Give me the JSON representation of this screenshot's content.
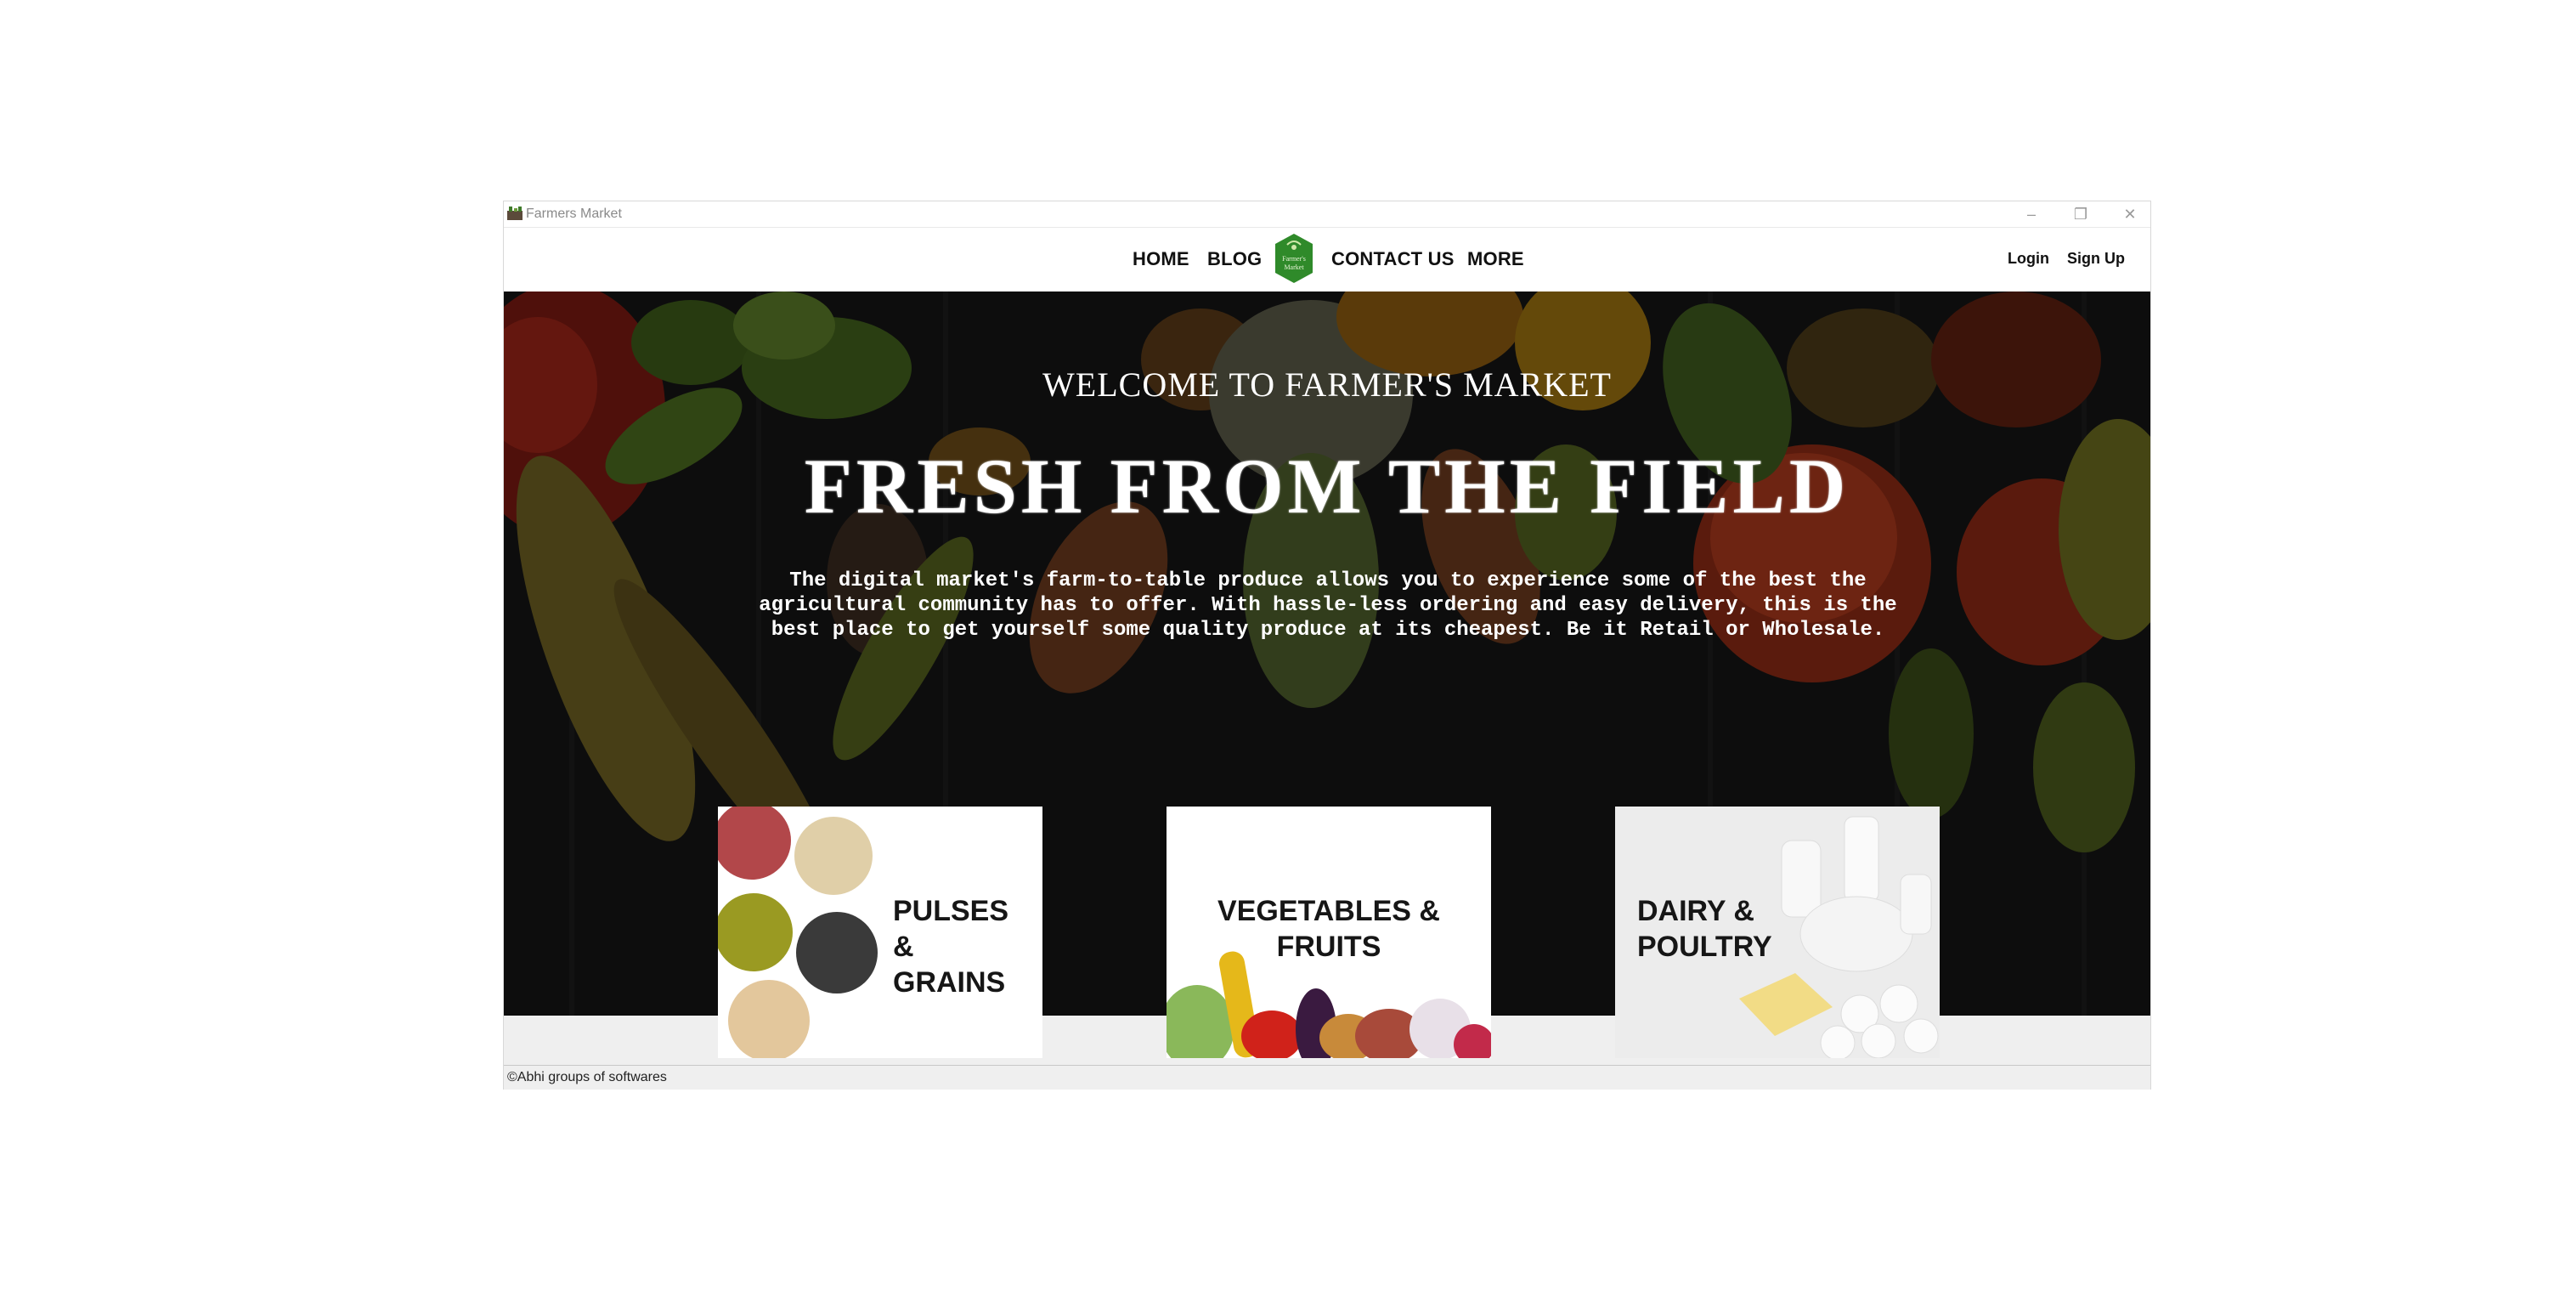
{
  "window": {
    "title": "Farmers Market"
  },
  "nav": {
    "items": [
      "HOME",
      "BLOG",
      "CONTACT US",
      "MORE"
    ],
    "logo_text": [
      "Farmer's",
      "Market"
    ],
    "login": "Login",
    "signup": "Sign Up"
  },
  "hero": {
    "welcome": "WELCOME TO FARMER'S MARKET",
    "headline": "FRESH FROM THE FIELD",
    "description": "The digital market's farm-to-table produce allows you to experience some of the best the agricultural community has to offer. With hassle-less ordering and easy delivery, this is the best place to get yourself some quality produce at its cheapest. Be it Retail or Wholesale."
  },
  "categories": [
    {
      "line1": "PULSES &",
      "line2": "GRAINS",
      "icon": "pulses-image"
    },
    {
      "line1": "VEGETABLES &",
      "line2": "FRUITS",
      "icon": "vegetables-image"
    },
    {
      "line1": "DAIRY &",
      "line2": "POULTRY",
      "icon": "dairy-image"
    }
  ],
  "status": {
    "text": "©Abhi groups of softwares"
  },
  "colors": {
    "logo_green": "#2f8a2a",
    "hero_bg": "#141414",
    "strip": "#efefef"
  }
}
